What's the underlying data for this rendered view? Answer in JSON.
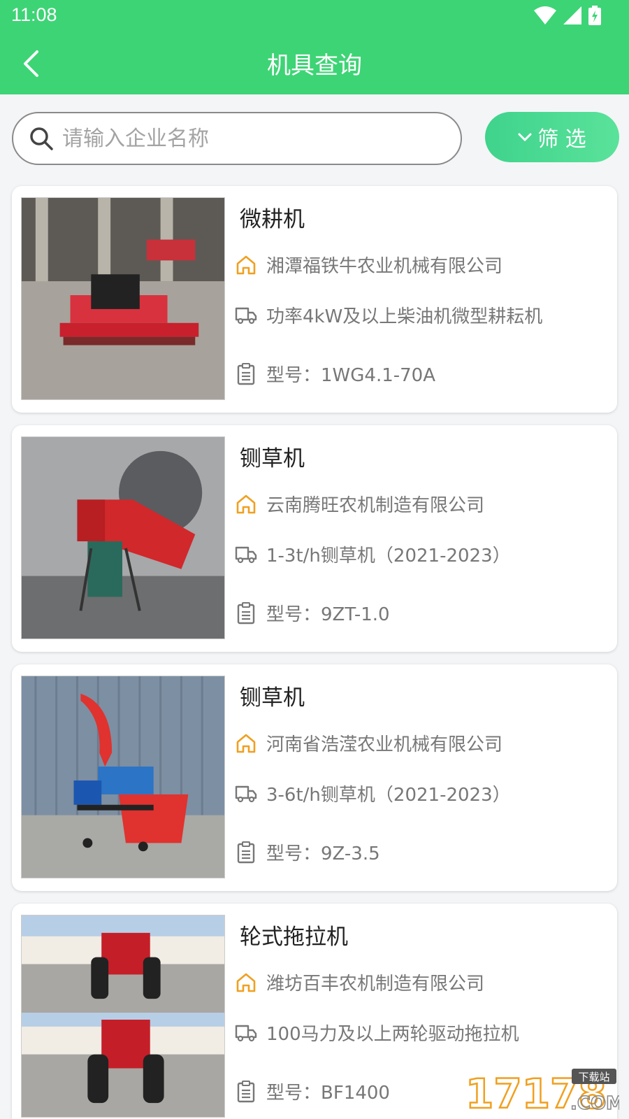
{
  "status": {
    "time": "11:08"
  },
  "header": {
    "title": "机具查询"
  },
  "search": {
    "placeholder": "请输入企业名称",
    "value": ""
  },
  "filter": {
    "label": "筛 选"
  },
  "items": [
    {
      "title": "微耕机",
      "company": "湘潭福铁牛农业机械有限公司",
      "spec": "功率4kW及以上柴油机微型耕耘机",
      "model": "型号：1WG4.1-70A"
    },
    {
      "title": "铡草机",
      "company": "云南腾旺农机制造有限公司",
      "spec": "1-3t/h铡草机（2021-2023）",
      "model": "型号：9ZT-1.0"
    },
    {
      "title": "铡草机",
      "company": "河南省浩滢农业机械有限公司",
      "spec": "3-6t/h铡草机（2021-2023）",
      "model": "型号：9Z-3.5"
    },
    {
      "title": "轮式拖拉机",
      "company": "潍坊百丰农机制造有限公司",
      "spec": "100马力及以上两轮驱动拖拉机",
      "model": "型号：BF1400"
    }
  ],
  "watermark": {
    "text": "17178",
    "sub": "下载站",
    "domain": ".COM"
  },
  "colors": {
    "header": "#3dd475",
    "accent_icon": "#f0a020",
    "filter_gradient_start": "#3fd38c",
    "filter_gradient_end": "#5ae29a"
  }
}
